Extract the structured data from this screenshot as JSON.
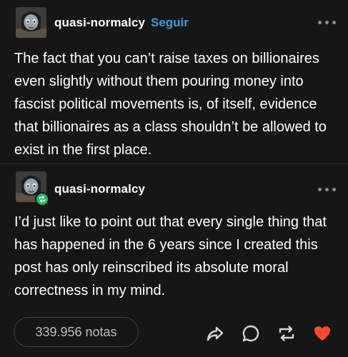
{
  "post": {
    "author": "quasi-normalcy",
    "follow_label": "Seguir",
    "text": "The fact that you can’t raise taxes on billionaires even slightly without them pouring money into fascist political movements is, of itself, evidence that billionaires as a class shouldn’t be allowed to exist in the first place."
  },
  "reblog": {
    "author": "quasi-normalcy",
    "text": "I’d just like to point out that every single thing that has happened in the 6 years since I created this post has only reinscribed its absolute moral correctness in my mind."
  },
  "footer": {
    "notes_label": "339.956 notas",
    "actions": [
      "share-icon",
      "reply-icon",
      "reblog-icon",
      "like-icon"
    ]
  },
  "colors": {
    "background": "#161616",
    "text": "#ffffff",
    "follow": "#3c9be0",
    "muted": "#8a8a8a",
    "reblog_badge": "#1fbe6a",
    "like": "#ff4930"
  }
}
